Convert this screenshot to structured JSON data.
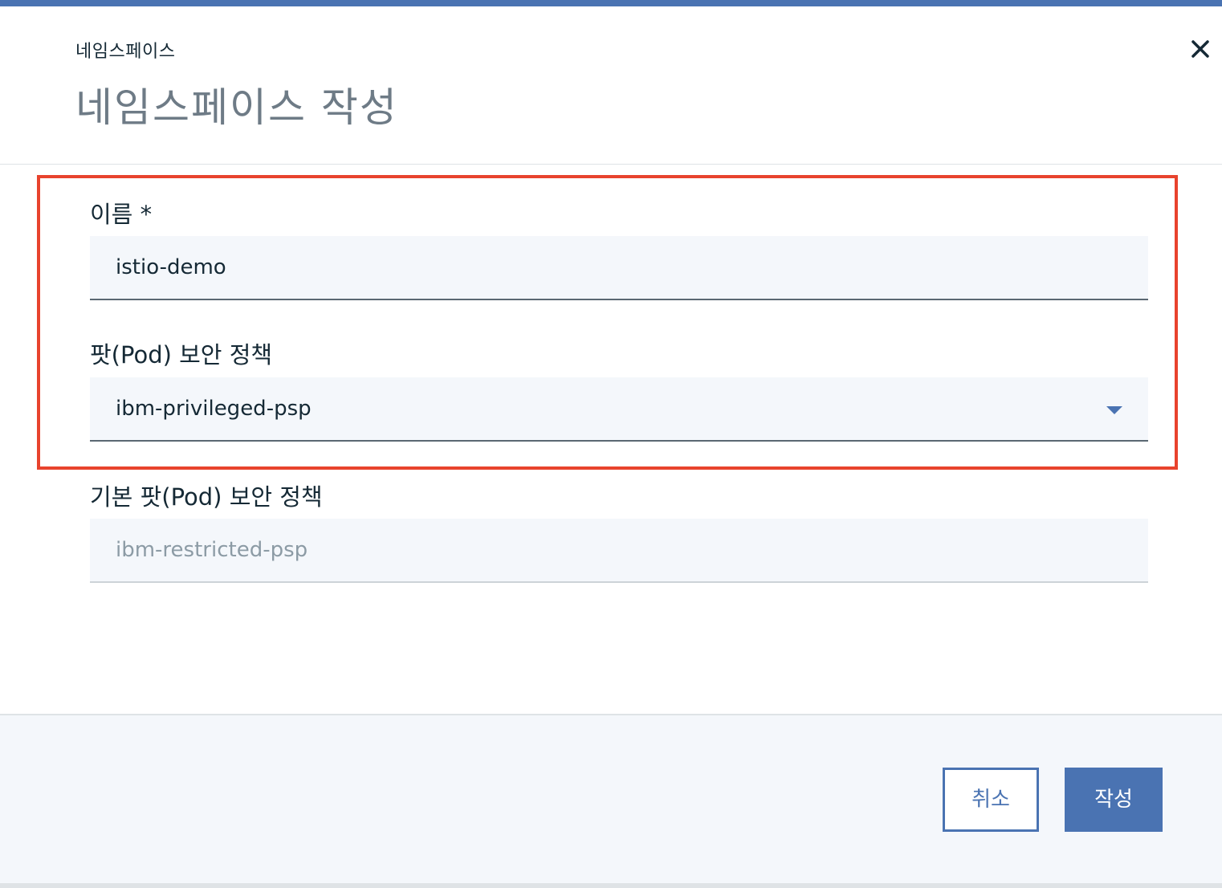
{
  "modal": {
    "label": "네임스페이스",
    "title": "네임스페이스 작성",
    "close_icon": "close-icon"
  },
  "form": {
    "name": {
      "label": "이름 *",
      "value": "istio-demo"
    },
    "pod_security_policy": {
      "label": "팟(Pod) 보안 정책",
      "value": "ibm-privileged-psp",
      "icon": "chevron-down-icon"
    },
    "default_pod_security_policy": {
      "label": "기본 팟(Pod) 보안 정책",
      "value": "ibm-restricted-psp"
    }
  },
  "footer": {
    "cancel_label": "취소",
    "create_label": "작성"
  },
  "colors": {
    "accent": "#4a73b2",
    "highlight": "#e8432d",
    "field_bg": "#f4f7fb"
  }
}
